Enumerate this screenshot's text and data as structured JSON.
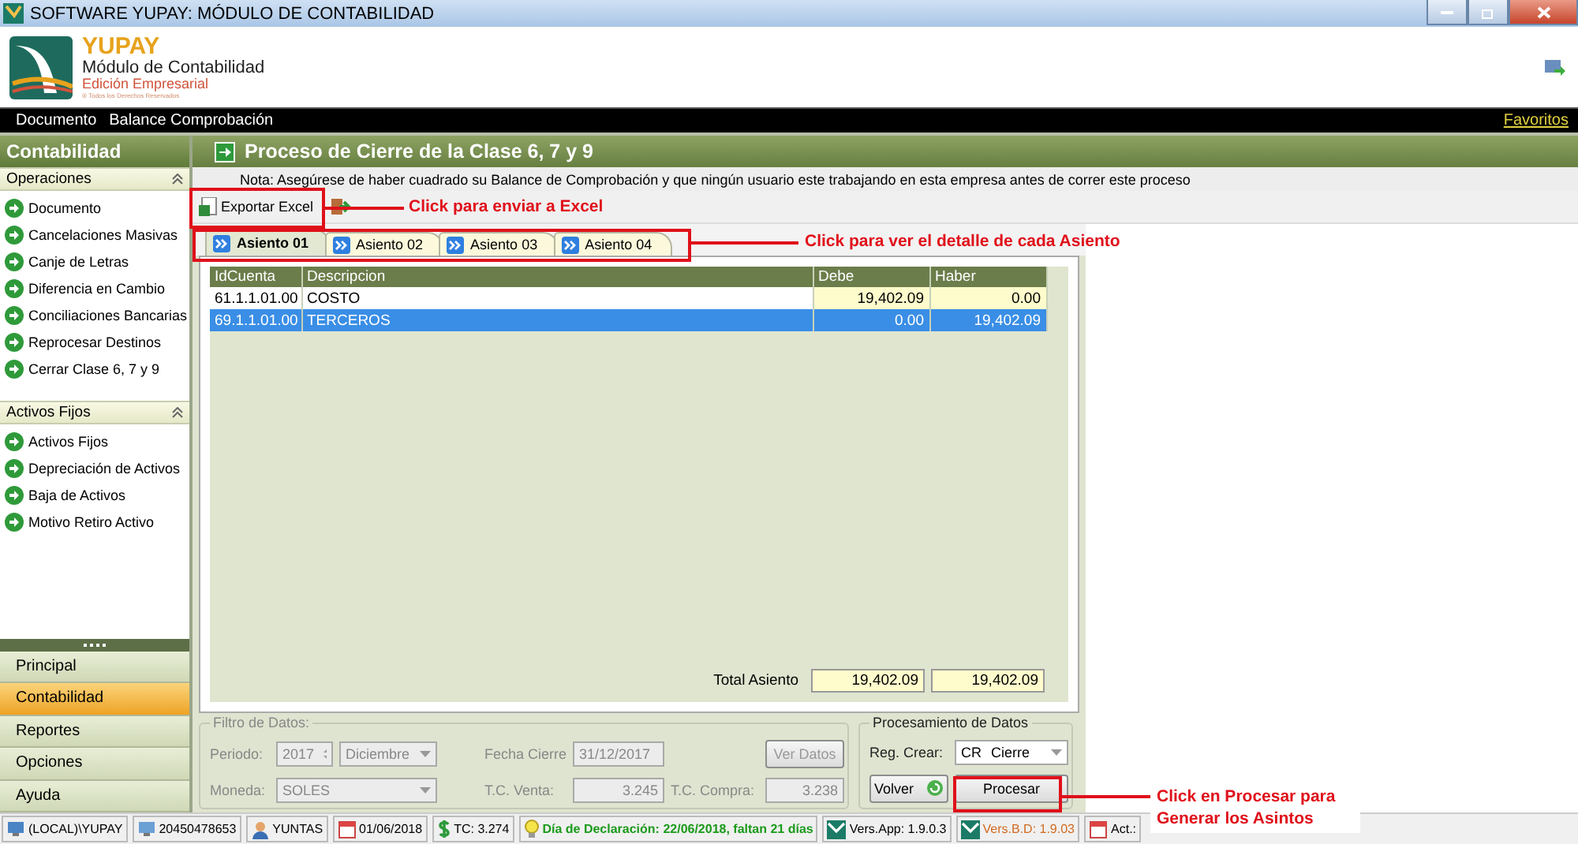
{
  "window": {
    "title": "SOFTWARE YUPAY: MÓDULO DE CONTABILIDAD"
  },
  "header": {
    "brand": "YUPAY",
    "module": "Módulo de Contabilidad",
    "edition": "Edición Empresarial",
    "rights": "® Todos los Derechos Reservados"
  },
  "menu": {
    "items": [
      "Documento",
      "Balance Comprobación"
    ],
    "favorites": "Favoritos"
  },
  "sidebar": {
    "title": "Contabilidad",
    "groups": [
      {
        "title": "Operaciones",
        "items": [
          "Documento",
          "Cancelaciones Masivas",
          "Canje de Letras",
          "Diferencia en Cambio",
          "Conciliaciones Bancarias",
          "Reprocesar Destinos",
          "Cerrar Clase 6, 7 y 9"
        ]
      },
      {
        "title": "Activos Fijos",
        "items": [
          "Activos Fijos",
          "Depreciación de Activos",
          "Baja de Activos",
          "Motivo Retiro Activo"
        ]
      }
    ],
    "nav": [
      {
        "label": "Principal",
        "selected": false
      },
      {
        "label": "Contabilidad",
        "selected": true
      },
      {
        "label": "Reportes",
        "selected": false
      },
      {
        "label": "Opciones",
        "selected": false
      },
      {
        "label": "Ayuda",
        "selected": false
      }
    ]
  },
  "content": {
    "title": "Proceso de Cierre de la Clase 6, 7 y 9",
    "note": "Nota: Asegúrese de haber cuadrado su Balance de Comprobación y que ningún usuario este trabajando en esta empresa antes de correr este proceso",
    "export_button": "Exportar Excel",
    "tabs": [
      {
        "label": "Asiento 01",
        "selected": true
      },
      {
        "label": "Asiento 02",
        "selected": false
      },
      {
        "label": "Asiento 03",
        "selected": false
      },
      {
        "label": "Asiento 04",
        "selected": false
      }
    ],
    "table": {
      "columns": [
        "IdCuenta",
        "Descripcion",
        "Debe",
        "Haber"
      ],
      "rows": [
        {
          "cells": [
            "61.1.1.01.00",
            "COSTO",
            "19,402.09",
            "0.00"
          ],
          "selected": false
        },
        {
          "cells": [
            "69.1.1.01.00",
            "TERCEROS",
            "0.00",
            "19,402.09"
          ],
          "selected": true
        }
      ]
    },
    "total": {
      "label": "Total Asiento",
      "debe": "19,402.09",
      "haber": "19,402.09"
    },
    "filter": {
      "title": "Filtro de Datos:",
      "disabled": true,
      "periodo_label": "Periodo:",
      "year": "2017",
      "month": "Diciembre",
      "moneda_label": "Moneda:",
      "moneda": "SOLES",
      "fecha_label": "Fecha Cierre",
      "fecha": "31/12/2017",
      "venta_label": "T.C. Venta:",
      "venta": "3.245",
      "compra_label": "T.C. Compra:",
      "compra": "3.238",
      "ver_button": "Ver Datos"
    },
    "processing": {
      "title": "Procesamiento de Datos",
      "reg_label": "Reg. Crear:",
      "reg_code": "CR",
      "reg_value": "Cierre",
      "back_button": "Volver",
      "process_button": "Procesar"
    }
  },
  "status_bar": [
    {
      "kind": "server",
      "text": "(LOCAL)\\YUPAY"
    },
    {
      "kind": "company",
      "text": "20450478653"
    },
    {
      "kind": "user",
      "text": "YUNTAS"
    },
    {
      "kind": "date",
      "text": "01/06/2018"
    },
    {
      "kind": "rate",
      "text": "TC: 3.274"
    },
    {
      "kind": "alert",
      "text": "Día de Declaración: 22/06/2018, faltan 21 días"
    },
    {
      "kind": "version",
      "text": "Vers.App: 1.9.0.3"
    },
    {
      "kind": "warning",
      "text": "Vers.B.D: 1.9.03"
    },
    {
      "kind": "date",
      "text": "Act.:"
    }
  ],
  "annotations": [
    {
      "text": "Click para enviar a Excel"
    },
    {
      "text": "Click para ver el detalle de cada Asiento"
    },
    {
      "text": "Click en Procesar para Generar los Asintos"
    }
  ]
}
